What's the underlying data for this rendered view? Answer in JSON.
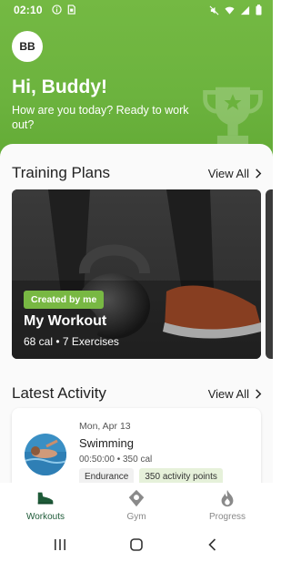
{
  "status_bar": {
    "time": "02:10",
    "left_icons": [
      "info-icon",
      "sim-icon"
    ],
    "right_icons": [
      "mute-icon",
      "wifi-icon",
      "signal-icon",
      "battery-icon"
    ]
  },
  "header": {
    "avatar_initials": "BB",
    "greeting": "Hi, Buddy!",
    "subtitle": "How are you today? Ready to work out?",
    "decor_icon": "trophy-icon"
  },
  "training_plans": {
    "title": "Training Plans",
    "view_all_label": "View All",
    "cards": [
      {
        "badge": "Created by me",
        "name": "My Workout",
        "meta": "68 cal • 7 Exercises",
        "image": "kettlebell-photo"
      }
    ]
  },
  "latest_activity": {
    "title": "Latest Activity",
    "view_all_label": "View All",
    "items": [
      {
        "date": "Mon, Apr 13",
        "name": "Swimming",
        "meta": "00:50:00 • 350 cal",
        "tags": [
          "Endurance",
          "350 activity points"
        ],
        "image": "swimmer-photo"
      }
    ]
  },
  "bottom_nav": {
    "items": [
      {
        "label": "Workouts",
        "icon": "shoe-icon",
        "active": true
      },
      {
        "label": "Gym",
        "icon": "location-pin-icon",
        "active": false
      },
      {
        "label": "Progress",
        "icon": "flame-icon",
        "active": false
      }
    ]
  },
  "colors": {
    "header_green": "#6cb33e",
    "badge_green": "#78b843",
    "active_nav": "#1e5a38",
    "points_tag_bg": "#e6f1da"
  }
}
